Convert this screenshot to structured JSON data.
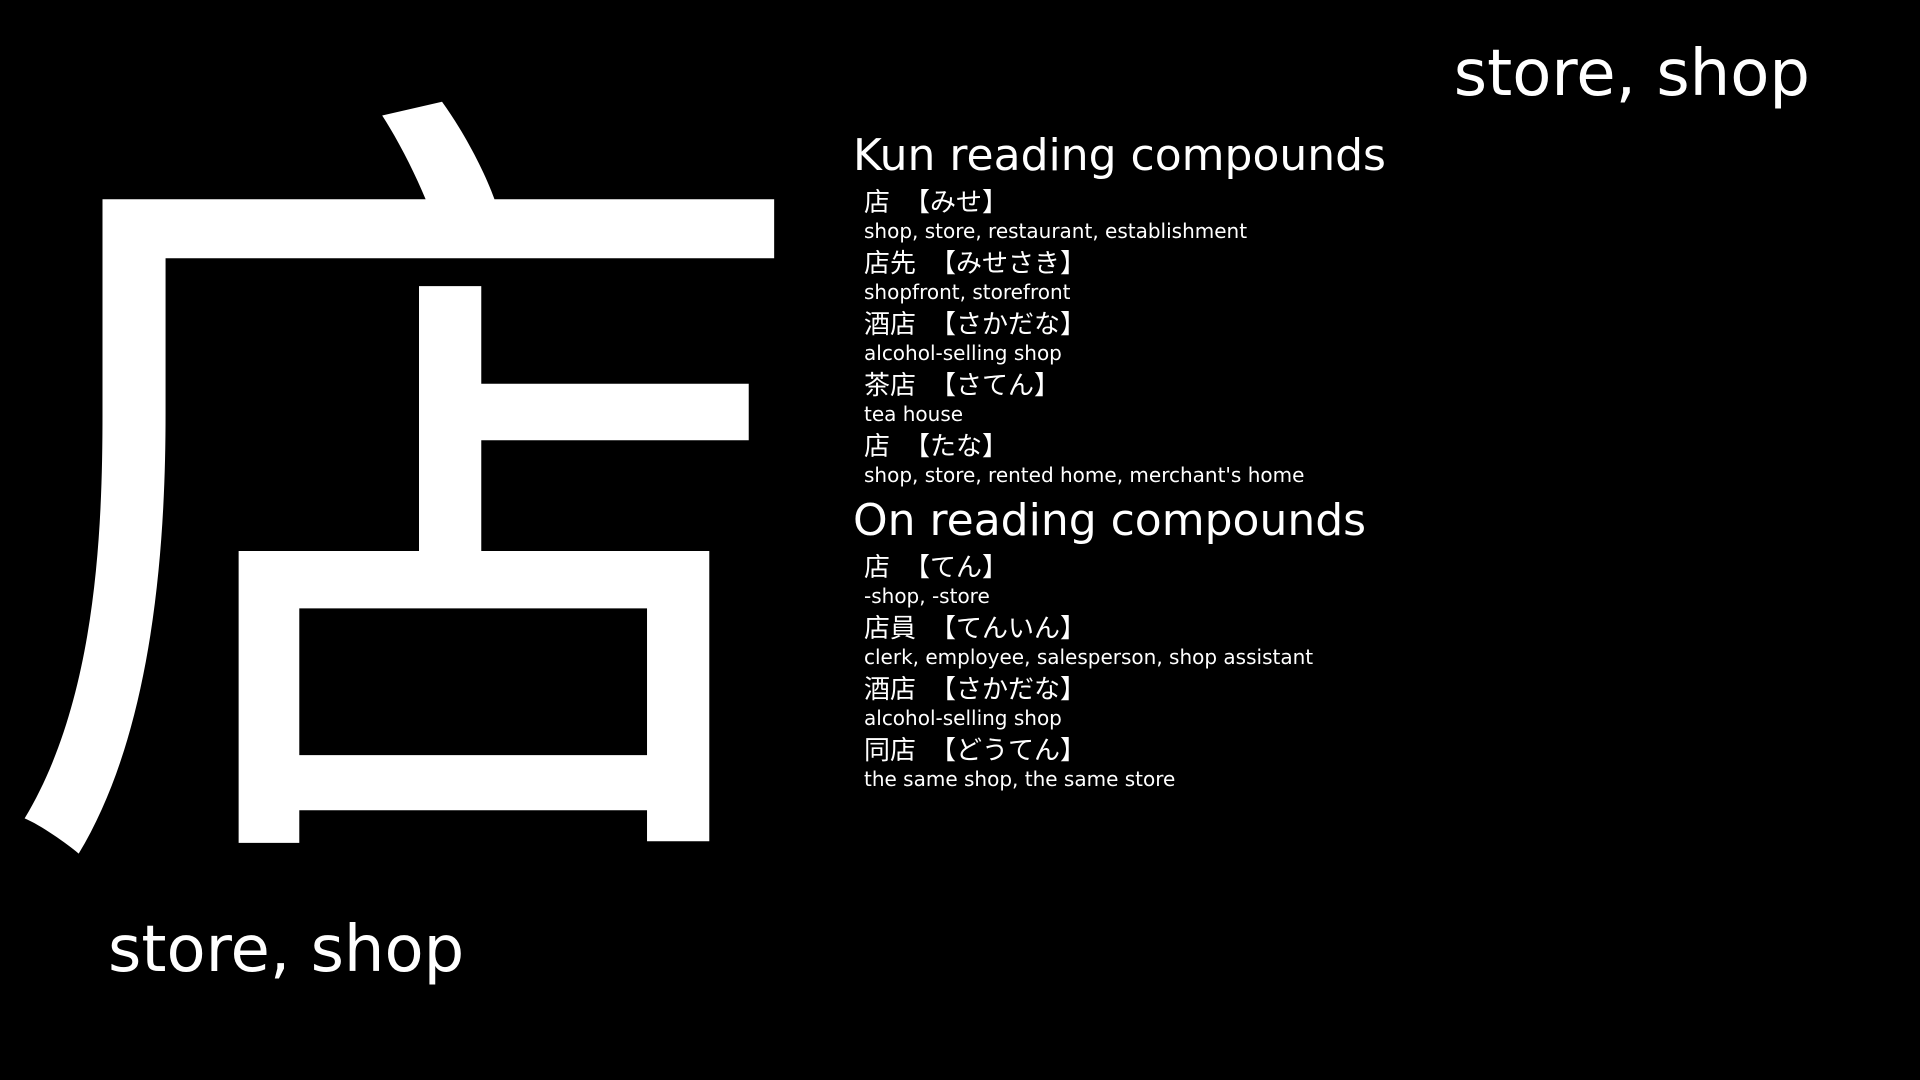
{
  "kanji": "店",
  "meaning": "store, shop",
  "kun_section": {
    "heading": "Kun reading compounds",
    "entries": [
      {
        "word": "店",
        "reading": "【みせ】",
        "gloss": "shop, store, restaurant, establishment"
      },
      {
        "word": "店先",
        "reading": "【みせさき】",
        "gloss": "shopfront, storefront"
      },
      {
        "word": "酒店",
        "reading": "【さかだな】",
        "gloss": "alcohol-selling shop"
      },
      {
        "word": "茶店",
        "reading": "【さてん】",
        "gloss": "tea house"
      },
      {
        "word": "店",
        "reading": "【たな】",
        "gloss": "shop, store, rented home, merchant's home"
      }
    ]
  },
  "on_section": {
    "heading": "On reading compounds",
    "entries": [
      {
        "word": "店",
        "reading": "【てん】",
        "gloss": "-shop, -store"
      },
      {
        "word": "店員",
        "reading": "【てんいん】",
        "gloss": "clerk, employee, salesperson, shop assistant"
      },
      {
        "word": "酒店",
        "reading": "【さかだな】",
        "gloss": "alcohol-selling shop"
      },
      {
        "word": "同店",
        "reading": "【どうてん】",
        "gloss": "the same shop, the same store"
      }
    ]
  },
  "colors": {
    "background": "#000000",
    "text": "#ffffff"
  }
}
